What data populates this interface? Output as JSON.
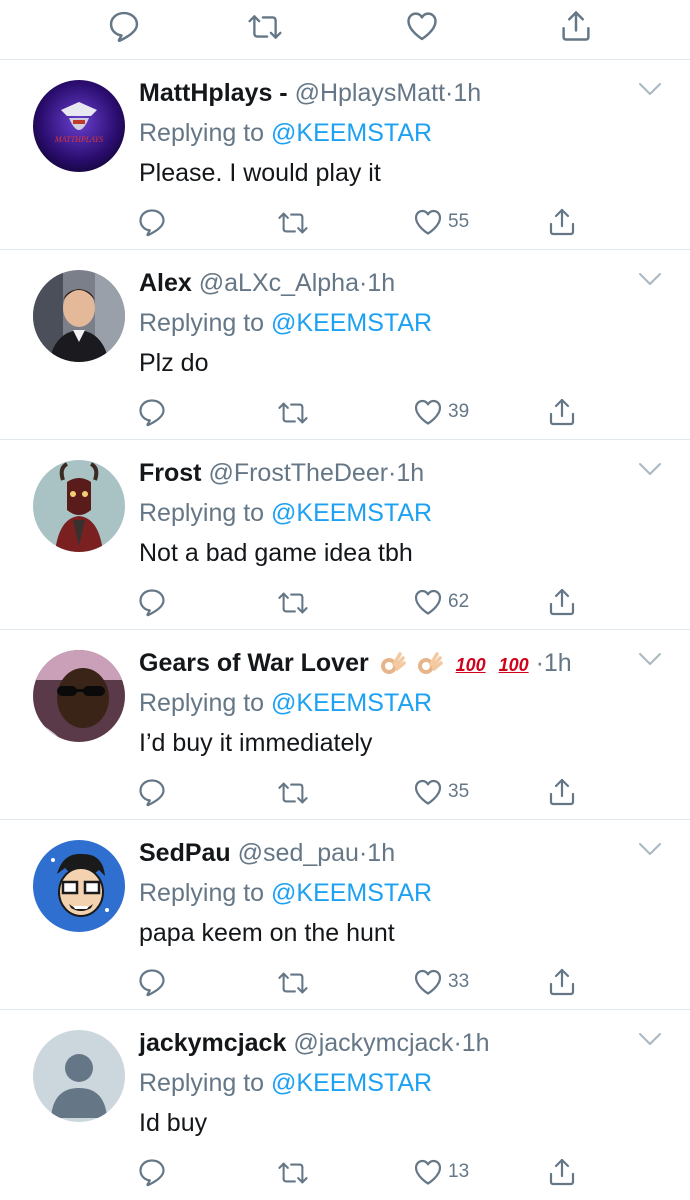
{
  "colors": {
    "accent": "#1da1f2",
    "secondary_text": "#657786",
    "divider": "#e1e8ed"
  },
  "top_actions": {
    "icons": [
      "reply-icon",
      "retweet-icon",
      "like-icon",
      "share-icon"
    ]
  },
  "replies": [
    {
      "name": "MattHplays -",
      "handle": "@HplaysMatt",
      "dot": "·",
      "time": "1h",
      "replying_prefix": "Replying to",
      "replying_to": "@KEEMSTAR",
      "text": "Please. I would play it",
      "likes": "55",
      "avatar_text": "MATTHPLAYS"
    },
    {
      "name": "Alex",
      "handle": "@aLXc_Alpha",
      "dot": "·",
      "time": "1h",
      "replying_prefix": "Replying to",
      "replying_to": "@KEEMSTAR",
      "text": "Plz do",
      "likes": "39"
    },
    {
      "name": "Frost",
      "handle": "@FrostTheDeer",
      "dot": "·",
      "time": "1h",
      "replying_prefix": "Replying to",
      "replying_to": "@KEEMSTAR",
      "text": "Not a bad game idea tbh",
      "likes": "62"
    },
    {
      "name": "Gears of War Lover",
      "handle": "",
      "dot": "·",
      "time": "1h",
      "replying_prefix": "Replying to",
      "replying_to": "@KEEMSTAR",
      "text": "I’d buy it immediately",
      "likes": "35",
      "name_emojis": [
        "ok-hand-emoji",
        "ok-hand-emoji",
        "hundred-points-emoji",
        "hundred-points-emoji"
      ],
      "hundred_text": "100"
    },
    {
      "name": "SedPau",
      "handle": "@sed_pau",
      "dot": "·",
      "time": "1h",
      "replying_prefix": "Replying to",
      "replying_to": "@KEEMSTAR",
      "text": "papa keem on the hunt",
      "likes": "33"
    },
    {
      "name": "jackymcjack",
      "handle": "@jackymcjack",
      "dot": "·",
      "time": "1h",
      "replying_prefix": "Replying to",
      "replying_to": "@KEEMSTAR",
      "text": "Id buy",
      "likes": "13"
    }
  ]
}
